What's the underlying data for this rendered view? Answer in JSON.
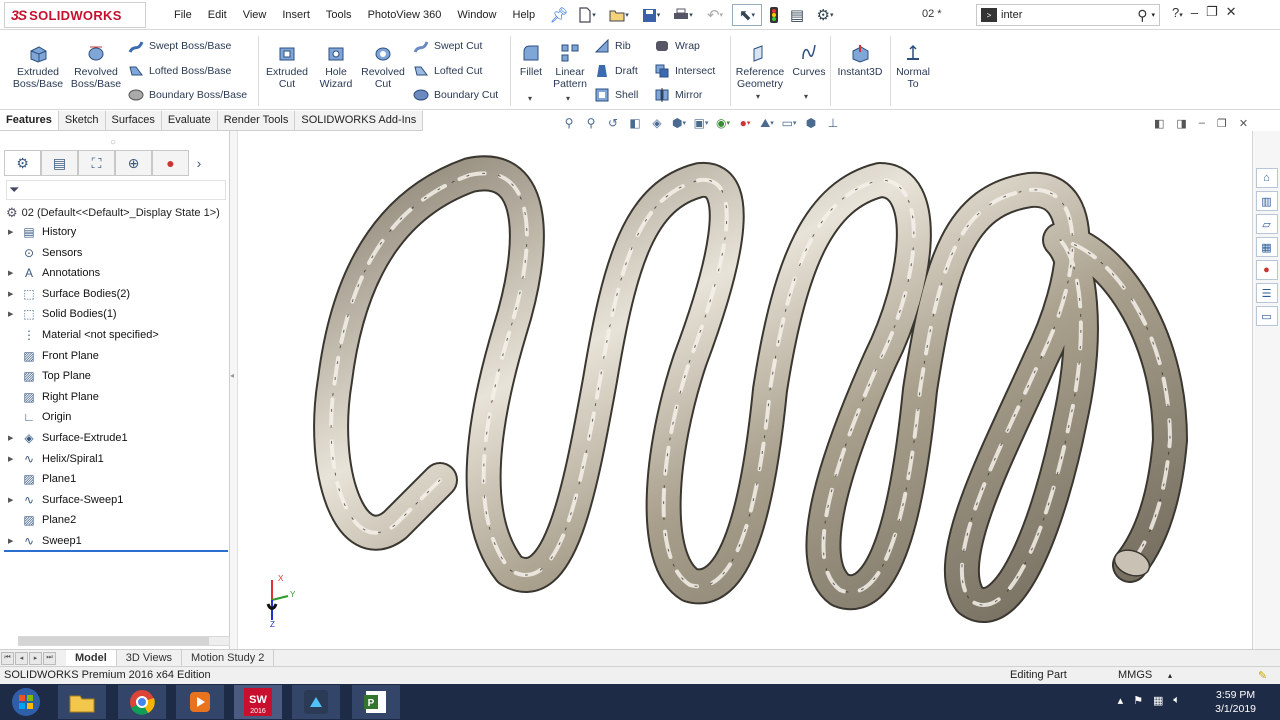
{
  "app": {
    "brand": "SOLIDWORKS",
    "brand_prefix": "3S",
    "document_title": "02 *",
    "edition": "SOLIDWORKS Premium 2016 x64 Edition"
  },
  "menu": [
    "File",
    "Edit",
    "View",
    "Insert",
    "Tools",
    "PhotoView 360",
    "Window",
    "Help"
  ],
  "search": {
    "value": "inter"
  },
  "features": {
    "extruded_boss": "Extruded\nBoss/Base",
    "revolved_boss": "Revolved\nBoss/Base",
    "swept_boss": "Swept Boss/Base",
    "lofted_boss": "Lofted Boss/Base",
    "boundary_boss": "Boundary Boss/Base",
    "extruded_cut": "Extruded\nCut",
    "hole_wizard": "Hole\nWizard",
    "revolved_cut": "Revolved\nCut",
    "swept_cut": "Swept Cut",
    "lofted_cut": "Lofted Cut",
    "boundary_cut": "Boundary Cut",
    "fillet": "Fillet",
    "linear_pattern": "Linear\nPattern",
    "rib": "Rib",
    "draft": "Draft",
    "shell": "Shell",
    "wrap": "Wrap",
    "intersect": "Intersect",
    "mirror": "Mirror",
    "reference_geometry": "Reference\nGeometry",
    "curves": "Curves",
    "instant3d": "Instant3D",
    "normal_to": "Normal\nTo"
  },
  "cm_tabs": [
    "Features",
    "Sketch",
    "Surfaces",
    "Evaluate",
    "Render Tools",
    "SOLIDWORKS Add-Ins"
  ],
  "tree": {
    "root": "02  (Default<<Default>_Display State 1>)",
    "items": [
      {
        "label": "History",
        "expand": true
      },
      {
        "label": "Sensors",
        "expand": false
      },
      {
        "label": "Annotations",
        "expand": true
      },
      {
        "label": "Surface Bodies(2)",
        "expand": true
      },
      {
        "label": "Solid Bodies(1)",
        "expand": true
      },
      {
        "label": "Material <not specified>",
        "expand": false
      },
      {
        "label": "Front Plane",
        "expand": false
      },
      {
        "label": "Top Plane",
        "expand": false
      },
      {
        "label": "Right Plane",
        "expand": false
      },
      {
        "label": "Origin",
        "expand": false
      },
      {
        "label": "Surface-Extrude1",
        "expand": true
      },
      {
        "label": "Helix/Spiral1",
        "expand": true
      },
      {
        "label": "Plane1",
        "expand": false
      },
      {
        "label": "Surface-Sweep1",
        "expand": true
      },
      {
        "label": "Plane2",
        "expand": false
      },
      {
        "label": "Sweep1",
        "expand": true
      }
    ]
  },
  "model_tabs": [
    "Model",
    "3D Views",
    "Motion Study 2"
  ],
  "status": {
    "mode": "Editing Part",
    "units": "MMGS"
  },
  "triad": {
    "x": "X",
    "y": "Y",
    "z": "Z"
  },
  "clock": {
    "time": "3:59 PM",
    "date": "3/1/2019"
  },
  "taskbar_apps": [
    "windows-start",
    "file-explorer",
    "chrome",
    "media-player",
    "solidworks-2016",
    "app-unknown",
    "project"
  ],
  "colors": {
    "brand_red": "#c8102e",
    "taskbar": "#1e2b46",
    "spring": "#b9b0a0"
  }
}
